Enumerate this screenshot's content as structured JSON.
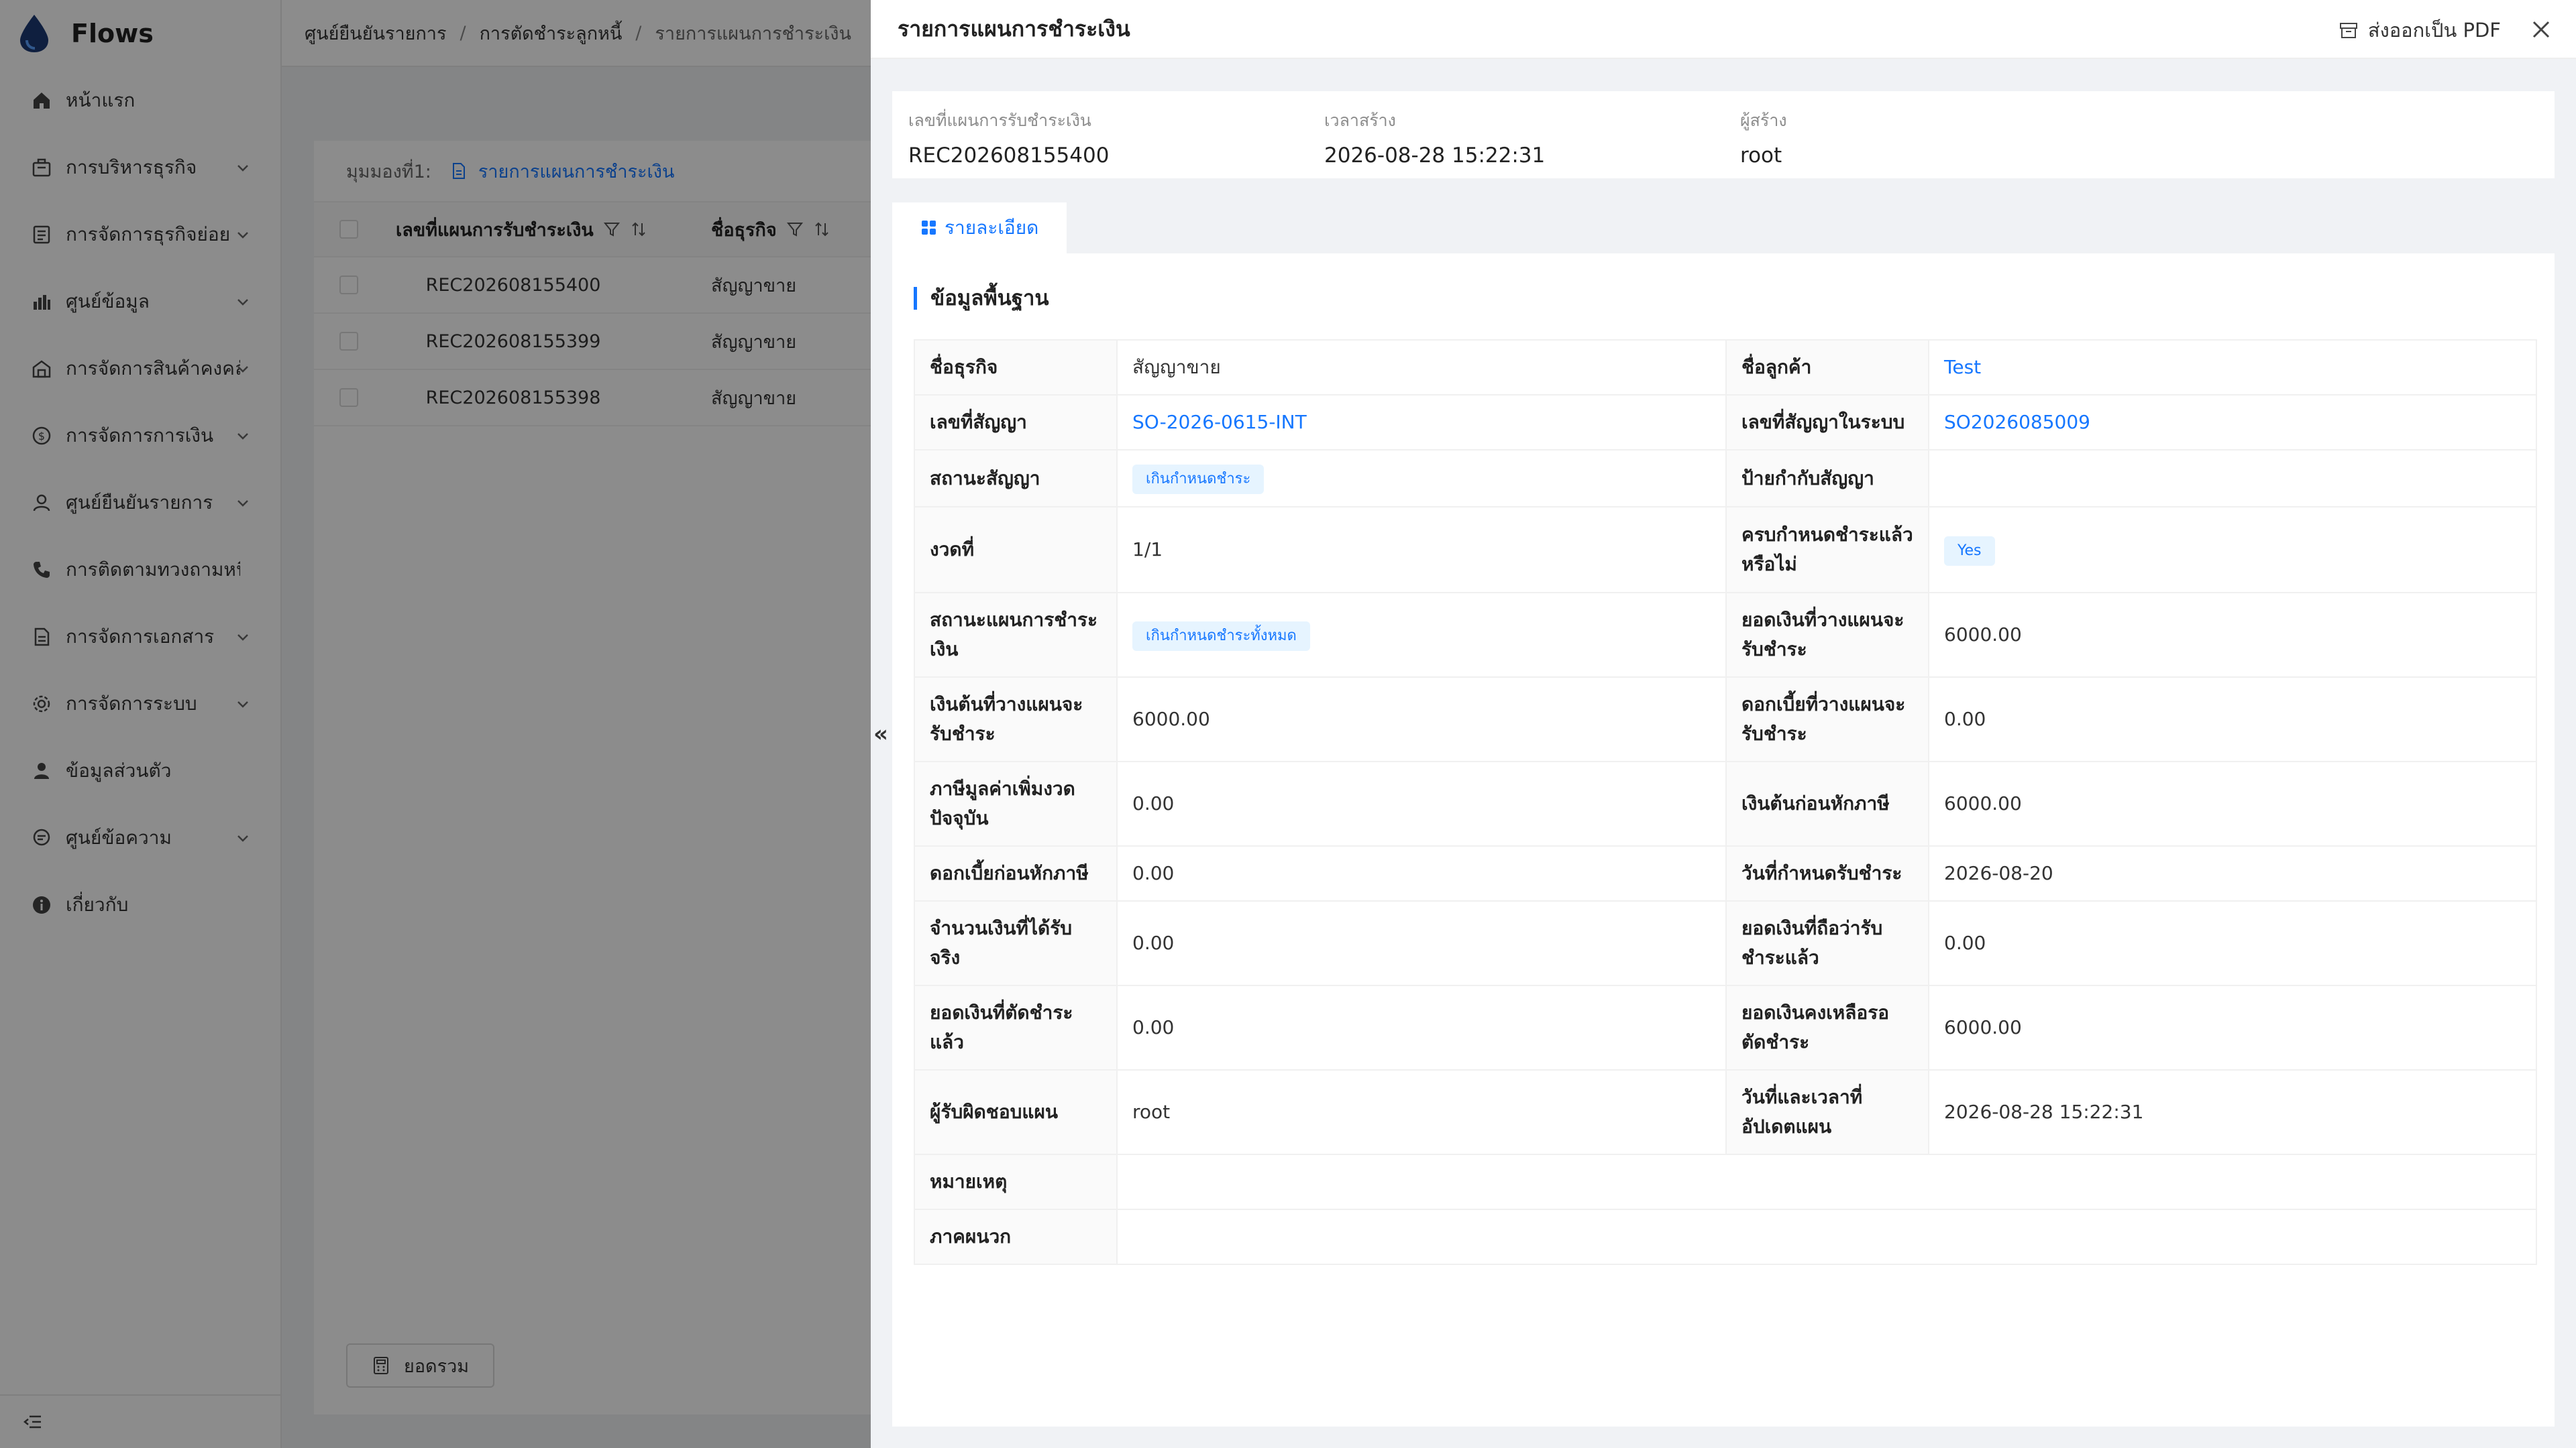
{
  "app": {
    "name": "Flows"
  },
  "sidebar": {
    "items": [
      {
        "label": "หน้าแรก",
        "icon": "home-icon",
        "expand": false
      },
      {
        "label": "การบริหารธุรกิจ",
        "icon": "briefcase-icon",
        "expand": true
      },
      {
        "label": "การจัดการธุรกิจย่อย",
        "icon": "document-list-icon",
        "expand": true
      },
      {
        "label": "ศูนย์ข้อมูล",
        "icon": "bar-chart-icon",
        "expand": true
      },
      {
        "label": "การจัดการสินค้าคงคลัง",
        "icon": "warehouse-icon",
        "expand": true
      },
      {
        "label": "การจัดการการเงิน",
        "icon": "money-icon",
        "expand": true
      },
      {
        "label": "ศูนย์ยืนยันรายการ",
        "icon": "user-check-icon",
        "expand": true
      },
      {
        "label": "การติดตามทวงถามหนี้",
        "icon": "phone-icon",
        "expand": false
      },
      {
        "label": "การจัดการเอกสาร",
        "icon": "file-icon",
        "expand": true
      },
      {
        "label": "การจัดการระบบ",
        "icon": "gear-icon",
        "expand": true
      },
      {
        "label": "ข้อมูลส่วนตัว",
        "icon": "person-icon",
        "expand": false
      },
      {
        "label": "ศูนย์ข้อความ",
        "icon": "message-icon",
        "expand": true
      },
      {
        "label": "เกี่ยวกับ",
        "icon": "info-icon",
        "expand": false
      }
    ]
  },
  "breadcrumb": [
    "ศูนย์ยืนยันรายการ",
    "การตัดชำระลูกหนี้",
    "รายการแผนการชำระเงิน"
  ],
  "list": {
    "view_label": "มุมมองที่1:",
    "view_name": "รายการแผนการชำระเงิน",
    "col1": "เลขที่แผนการรับชำระเงิน",
    "col2": "ชื่อธุรกิจ",
    "rows": [
      {
        "no": "REC202608155400",
        "biz": "สัญญาขาย"
      },
      {
        "no": "REC202608155399",
        "biz": "สัญญาขาย"
      },
      {
        "no": "REC202608155398",
        "biz": "สัญญาขาย"
      }
    ],
    "sum_label": "ยอดรวม"
  },
  "drawer": {
    "title": "รายการแผนการชำระเงิน",
    "export_label": "ส่งออกเป็น PDF",
    "collapse_glyph": "«",
    "meta": [
      {
        "label": "เลขที่แผนการรับชำระเงิน",
        "value": "REC202608155400"
      },
      {
        "label": "เวลาสร้าง",
        "value": "2026-08-28 15:22:31"
      },
      {
        "label": "ผู้สร้าง",
        "value": "root"
      }
    ],
    "tab_label": "รายละเอียด",
    "section_title": "ข้อมูลพื้นฐาน",
    "rows": [
      {
        "l1": "ชื่อธุรกิจ",
        "v1": "สัญญาขาย",
        "l2": "ชื่อลูกค้า",
        "v2": "Test"
      },
      {
        "l1": "เลขที่สัญญา",
        "v1": "SO-2026-0615-INT",
        "l2": "เลขที่สัญญาในระบบ",
        "v2": "SO2026085009"
      },
      {
        "l1": "สถานะสัญญา",
        "v1": "เกินกำหนดชำระ",
        "l2": "ป้ายกำกับสัญญา",
        "v2": ""
      },
      {
        "l1": "งวดที่",
        "v1": "1/1",
        "l2": "ครบกำหนดชำระแล้วหรือไม่",
        "v2": "Yes"
      },
      {
        "l1": "สถานะแผนการชำระเงิน",
        "v1": "เกินกำหนดชำระทั้งหมด",
        "l2": "ยอดเงินที่วางแผนจะรับชำระ",
        "v2": "6000.00"
      },
      {
        "l1": "เงินต้นที่วางแผนจะรับชำระ",
        "v1": "6000.00",
        "l2": "ดอกเบี้ยที่วางแผนจะรับชำระ",
        "v2": "0.00"
      },
      {
        "l1": "ภาษีมูลค่าเพิ่มงวดปัจจุบัน",
        "v1": "0.00",
        "l2": "เงินต้นก่อนหักภาษี",
        "v2": "6000.00"
      },
      {
        "l1": "ดอกเบี้ยก่อนหักภาษี",
        "v1": "0.00",
        "l2": "วันที่กำหนดรับชำระ",
        "v2": "2026-08-20"
      },
      {
        "l1": "จำนวนเงินที่ได้รับจริง",
        "v1": "0.00",
        "l2": "ยอดเงินที่ถือว่ารับชำระแล้ว",
        "v2": "0.00"
      },
      {
        "l1": "ยอดเงินที่ตัดชำระแล้ว",
        "v1": "0.00",
        "l2": "ยอดเงินคงเหลือรอตัดชำระ",
        "v2": "6000.00"
      },
      {
        "l1": "ผู้รับผิดชอบแผน",
        "v1": "root",
        "l2": "วันที่และเวลาที่อัปเดตแผน",
        "v2": "2026-08-28 15:22:31"
      }
    ],
    "remark_label": "หมายเหตุ",
    "remark_value": "",
    "attach_label": "ภาคผนวก",
    "attach_value": ""
  },
  "colors": {
    "accent": "#1677ff",
    "tag_bg": "#e6f4ff",
    "overlay": "rgba(0,0,0,0.45)"
  }
}
